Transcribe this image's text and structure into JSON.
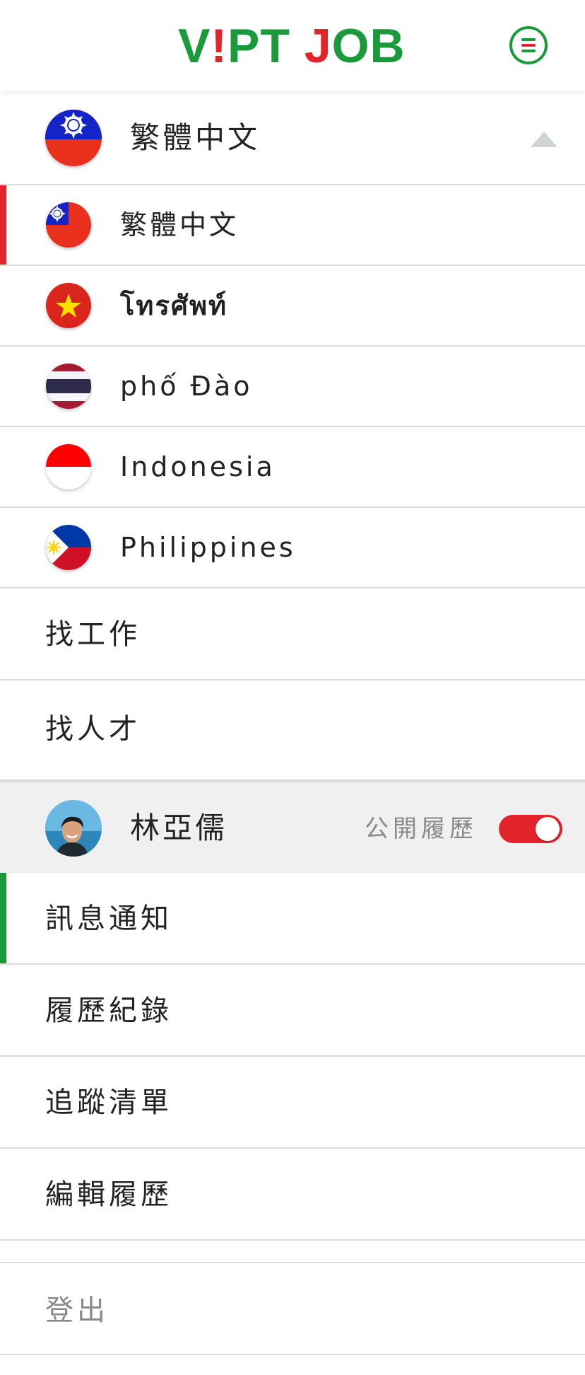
{
  "header": {
    "logo_parts": [
      {
        "text": "V",
        "color": "#1a9a3a"
      },
      {
        "text": "!",
        "color": "#e3242b"
      },
      {
        "text": "PT",
        "color": "#1a9a3a"
      },
      {
        "text": " ",
        "color": "#1a9a3a"
      },
      {
        "text": "J",
        "color": "#e3242b"
      },
      {
        "text": "OB",
        "color": "#1a9a3a"
      }
    ],
    "menu_icon": "hamburger-circle-icon"
  },
  "language": {
    "current_label": "繁體中文",
    "expanded": true,
    "options": [
      {
        "label": "繁體中文",
        "flag": "taiwan-flag-icon",
        "active": true
      },
      {
        "label": "โทรศัพท์",
        "flag": "vietnam-flag-icon",
        "active": false
      },
      {
        "label": "phố Đào",
        "flag": "thailand-flag-icon",
        "active": false
      },
      {
        "label": "Indonesia",
        "flag": "indonesia-flag-icon",
        "active": false
      },
      {
        "label": "Philippines",
        "flag": "philippines-flag-icon",
        "active": false
      }
    ]
  },
  "nav": {
    "find_job": "找工作",
    "find_talent": "找人才"
  },
  "user": {
    "name": "林亞儒",
    "public_resume_label": "公開履歷",
    "public_resume_on": true
  },
  "user_menu": {
    "notifications": "訊息通知",
    "resume_records": "履歷紀錄",
    "tracking_list": "追蹤清單",
    "edit_resume": "編輯履歷",
    "logout": "登出"
  },
  "colors": {
    "brand_green": "#1a9a3a",
    "brand_red": "#e3242b"
  }
}
